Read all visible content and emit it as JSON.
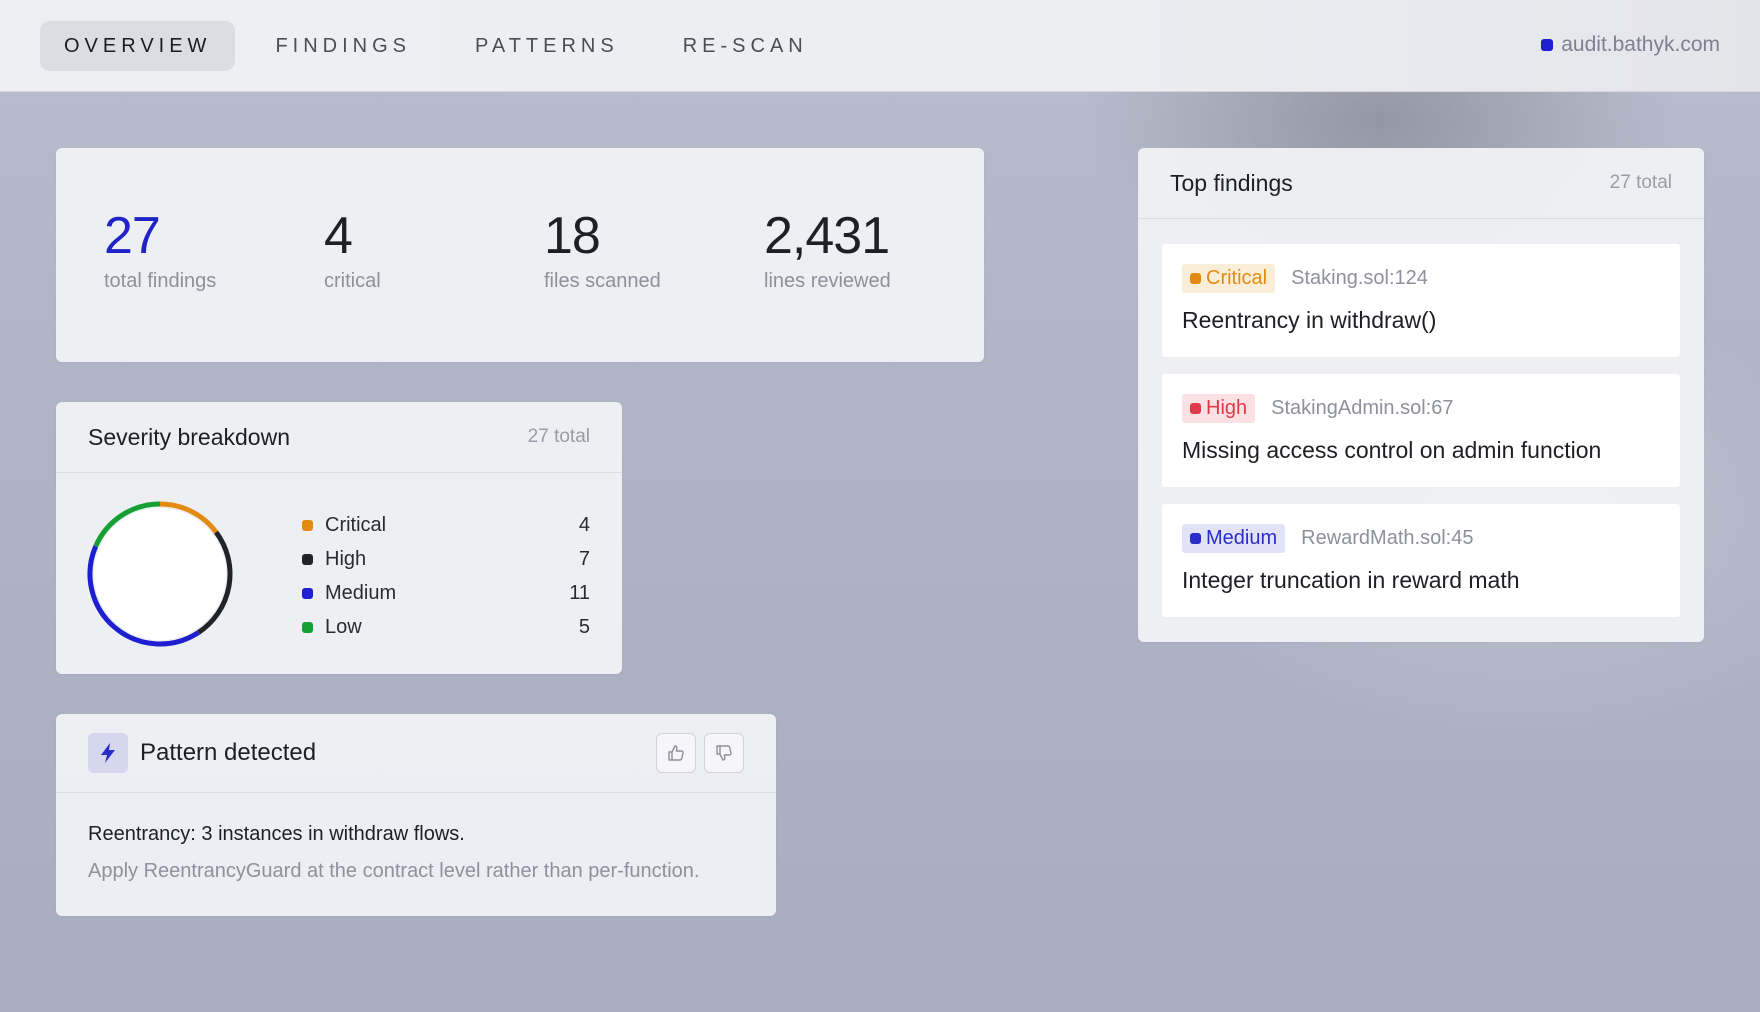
{
  "nav": {
    "tabs": [
      {
        "label": "OVERVIEW",
        "active": true
      },
      {
        "label": "FINDINGS",
        "active": false
      },
      {
        "label": "PATTERNS",
        "active": false
      },
      {
        "label": "RE-SCAN",
        "active": false
      }
    ],
    "domain": "audit.bathyk.com",
    "domain_dot_color": "#1d1fd0"
  },
  "stats": [
    {
      "value": "27",
      "label": "total findings",
      "accent": true
    },
    {
      "value": "4",
      "label": "critical",
      "accent": false
    },
    {
      "value": "18",
      "label": "files scanned",
      "accent": false
    },
    {
      "value": "2,431",
      "label": "lines reviewed",
      "accent": false
    }
  ],
  "severity": {
    "title": "Severity breakdown",
    "meta": "27 total",
    "items": [
      {
        "name": "Critical",
        "count": 4,
        "color": "#e38b10"
      },
      {
        "name": "High",
        "count": 7,
        "color": "#222328"
      },
      {
        "name": "Medium",
        "count": 11,
        "color": "#1d1fd0"
      },
      {
        "name": "Low",
        "count": 5,
        "color": "#16a034"
      }
    ]
  },
  "pattern": {
    "title": "Pattern detected",
    "icon": "bolt-icon",
    "line1": "Reentrancy: 3 instances in withdraw flows.",
    "line2": "Apply ReentrancyGuard at the contract level rather than per-function.",
    "vote_icons": [
      "thumbs-up-icon",
      "thumbs-down-icon"
    ]
  },
  "top_findings": {
    "title": "Top findings",
    "meta": "27 total",
    "items": [
      {
        "severity": "Critical",
        "severity_class": "critical",
        "location": "Staking.sol:124",
        "title": "Reentrancy in withdraw()"
      },
      {
        "severity": "High",
        "severity_class": "high",
        "location": "StakingAdmin.sol:67",
        "title": "Missing access control on admin function"
      },
      {
        "severity": "Medium",
        "severity_class": "medium",
        "location": "RewardMath.sol:45",
        "title": "Integer truncation in reward math"
      }
    ]
  }
}
